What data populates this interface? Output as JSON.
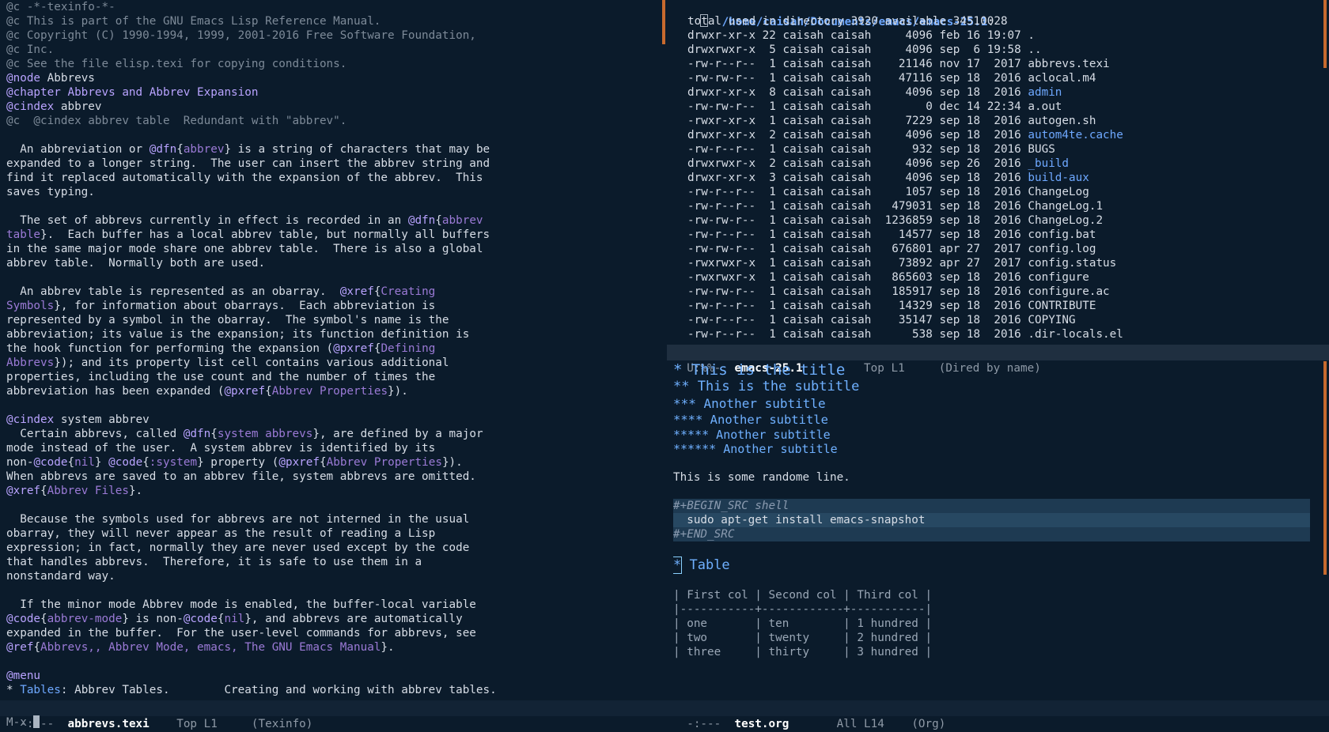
{
  "left_buffer": {
    "lines": [
      {
        "parts": [
          {
            "c": "comment",
            "t": "@c -*-texinfo-*-"
          }
        ]
      },
      {
        "parts": [
          {
            "c": "comment",
            "t": "@c This is part of the GNU Emacs Lisp Reference Manual."
          }
        ]
      },
      {
        "parts": [
          {
            "c": "comment",
            "t": "@c Copyright (C) 1990-1994, 1999, 2001-2016 Free Software Foundation,"
          }
        ]
      },
      {
        "parts": [
          {
            "c": "comment",
            "t": "@c Inc."
          }
        ]
      },
      {
        "parts": [
          {
            "c": "comment",
            "t": "@c See the file elisp.texi for copying conditions."
          }
        ]
      },
      {
        "parts": [
          {
            "c": "kw",
            "t": "@node"
          },
          {
            "c": "",
            "t": " Abbrevs"
          }
        ]
      },
      {
        "parts": [
          {
            "c": "kw",
            "t": "@chapter Abbrevs and Abbrev Expansion"
          }
        ]
      },
      {
        "parts": [
          {
            "c": "kw",
            "t": "@cindex"
          },
          {
            "c": "",
            "t": " abbrev"
          }
        ]
      },
      {
        "parts": [
          {
            "c": "comment",
            "t": "@c  @cindex abbrev table  Redundant with \"abbrev\"."
          }
        ]
      },
      {
        "parts": [
          {
            "c": "",
            "t": ""
          }
        ]
      },
      {
        "parts": [
          {
            "c": "",
            "t": "  An abbreviation or "
          },
          {
            "c": "kw",
            "t": "@dfn"
          },
          {
            "c": "",
            "t": "{"
          },
          {
            "c": "arg",
            "t": "abbrev"
          },
          {
            "c": "",
            "t": "} is a string of characters that may be"
          }
        ]
      },
      {
        "parts": [
          {
            "c": "",
            "t": "expanded to a longer string.  The user can insert the abbrev string and"
          }
        ]
      },
      {
        "parts": [
          {
            "c": "",
            "t": "find it replaced automatically with the expansion of the abbrev.  This"
          }
        ]
      },
      {
        "parts": [
          {
            "c": "",
            "t": "saves typing."
          }
        ]
      },
      {
        "parts": [
          {
            "c": "",
            "t": ""
          }
        ]
      },
      {
        "parts": [
          {
            "c": "",
            "t": "  The set of abbrevs currently in effect is recorded in an "
          },
          {
            "c": "kw",
            "t": "@dfn"
          },
          {
            "c": "",
            "t": "{"
          },
          {
            "c": "arg",
            "t": "abbrev"
          }
        ]
      },
      {
        "parts": [
          {
            "c": "arg",
            "t": "table"
          },
          {
            "c": "",
            "t": "}.  Each buffer has a local abbrev table, but normally all buffers"
          }
        ]
      },
      {
        "parts": [
          {
            "c": "",
            "t": "in the same major mode share one abbrev table.  There is also a global"
          }
        ]
      },
      {
        "parts": [
          {
            "c": "",
            "t": "abbrev table.  Normally both are used."
          }
        ]
      },
      {
        "parts": [
          {
            "c": "",
            "t": ""
          }
        ]
      },
      {
        "parts": [
          {
            "c": "",
            "t": "  An abbrev table is represented as an obarray.  "
          },
          {
            "c": "kw",
            "t": "@xref"
          },
          {
            "c": "",
            "t": "{"
          },
          {
            "c": "arg",
            "t": "Creating"
          }
        ]
      },
      {
        "parts": [
          {
            "c": "arg",
            "t": "Symbols"
          },
          {
            "c": "",
            "t": "}, for information about obarrays.  Each abbreviation is"
          }
        ]
      },
      {
        "parts": [
          {
            "c": "",
            "t": "represented by a symbol in the obarray.  The symbol's name is the"
          }
        ]
      },
      {
        "parts": [
          {
            "c": "",
            "t": "abbreviation; its value is the expansion; its function definition is"
          }
        ]
      },
      {
        "parts": [
          {
            "c": "",
            "t": "the hook function for performing the expansion ("
          },
          {
            "c": "kw",
            "t": "@pxref"
          },
          {
            "c": "",
            "t": "{"
          },
          {
            "c": "arg",
            "t": "Defining"
          }
        ]
      },
      {
        "parts": [
          {
            "c": "arg",
            "t": "Abbrevs"
          },
          {
            "c": "",
            "t": "}); and its property list cell contains various additional"
          }
        ]
      },
      {
        "parts": [
          {
            "c": "",
            "t": "properties, including the use count and the number of times the"
          }
        ]
      },
      {
        "parts": [
          {
            "c": "",
            "t": "abbreviation has been expanded ("
          },
          {
            "c": "kw",
            "t": "@pxref"
          },
          {
            "c": "",
            "t": "{"
          },
          {
            "c": "arg",
            "t": "Abbrev Properties"
          },
          {
            "c": "",
            "t": "})."
          }
        ]
      },
      {
        "parts": [
          {
            "c": "",
            "t": ""
          }
        ]
      },
      {
        "parts": [
          {
            "c": "kw",
            "t": "@cindex"
          },
          {
            "c": "",
            "t": " system abbrev"
          }
        ]
      },
      {
        "parts": [
          {
            "c": "",
            "t": "  Certain abbrevs, called "
          },
          {
            "c": "kw",
            "t": "@dfn"
          },
          {
            "c": "",
            "t": "{"
          },
          {
            "c": "arg",
            "t": "system abbrevs"
          },
          {
            "c": "",
            "t": "}, are defined by a major"
          }
        ]
      },
      {
        "parts": [
          {
            "c": "",
            "t": "mode instead of the user.  A system abbrev is identified by its"
          }
        ]
      },
      {
        "parts": [
          {
            "c": "",
            "t": "non-"
          },
          {
            "c": "kw",
            "t": "@code"
          },
          {
            "c": "",
            "t": "{"
          },
          {
            "c": "arg",
            "t": "nil"
          },
          {
            "c": "",
            "t": "} "
          },
          {
            "c": "kw",
            "t": "@code"
          },
          {
            "c": "",
            "t": "{"
          },
          {
            "c": "arg",
            "t": ":system"
          },
          {
            "c": "",
            "t": "} property ("
          },
          {
            "c": "kw",
            "t": "@pxref"
          },
          {
            "c": "",
            "t": "{"
          },
          {
            "c": "arg",
            "t": "Abbrev Properties"
          },
          {
            "c": "",
            "t": "})."
          }
        ]
      },
      {
        "parts": [
          {
            "c": "",
            "t": "When abbrevs are saved to an abbrev file, system abbrevs are omitted."
          }
        ]
      },
      {
        "parts": [
          {
            "c": "kw",
            "t": "@xref"
          },
          {
            "c": "",
            "t": "{"
          },
          {
            "c": "arg",
            "t": "Abbrev Files"
          },
          {
            "c": "",
            "t": "}."
          }
        ]
      },
      {
        "parts": [
          {
            "c": "",
            "t": ""
          }
        ]
      },
      {
        "parts": [
          {
            "c": "",
            "t": "  Because the symbols used for abbrevs are not interned in the usual"
          }
        ]
      },
      {
        "parts": [
          {
            "c": "",
            "t": "obarray, they will never appear as the result of reading a Lisp"
          }
        ]
      },
      {
        "parts": [
          {
            "c": "",
            "t": "expression; in fact, normally they are never used except by the code"
          }
        ]
      },
      {
        "parts": [
          {
            "c": "",
            "t": "that handles abbrevs.  Therefore, it is safe to use them in a"
          }
        ]
      },
      {
        "parts": [
          {
            "c": "",
            "t": "nonstandard way."
          }
        ]
      },
      {
        "parts": [
          {
            "c": "",
            "t": ""
          }
        ]
      },
      {
        "parts": [
          {
            "c": "",
            "t": "  If the minor mode Abbrev mode is enabled, the buffer-local variable"
          }
        ]
      },
      {
        "parts": [
          {
            "c": "kw",
            "t": "@code"
          },
          {
            "c": "",
            "t": "{"
          },
          {
            "c": "arg",
            "t": "abbrev-mode"
          },
          {
            "c": "",
            "t": "} is non-"
          },
          {
            "c": "kw",
            "t": "@code"
          },
          {
            "c": "",
            "t": "{"
          },
          {
            "c": "arg",
            "t": "nil"
          },
          {
            "c": "",
            "t": "}, and abbrevs are automatically"
          }
        ]
      },
      {
        "parts": [
          {
            "c": "",
            "t": "expanded in the buffer.  For the user-level commands for abbrevs, see"
          }
        ]
      },
      {
        "parts": [
          {
            "c": "kw",
            "t": "@ref"
          },
          {
            "c": "",
            "t": "{"
          },
          {
            "c": "arg",
            "t": "Abbrevs,, Abbrev Mode, emacs, The GNU Emacs Manual"
          },
          {
            "c": "",
            "t": "}."
          }
        ]
      },
      {
        "parts": [
          {
            "c": "",
            "t": ""
          }
        ]
      },
      {
        "parts": [
          {
            "c": "kw",
            "t": "@menu"
          }
        ]
      },
      {
        "parts": [
          {
            "c": "",
            "t": "* "
          },
          {
            "c": "dir",
            "t": "Tables"
          },
          {
            "c": "",
            "t": ": Abbrev Tables.        Creating and working with abbrev tables."
          }
        ]
      }
    ],
    "modeline": {
      "status": "-:---",
      "name": "abbrevs.texi",
      "position": "Top L1",
      "mode": "(Texinfo)"
    }
  },
  "dired": {
    "header": "/home/caisah/Documents/emacs/emacs-25.1",
    "header_suffix": ":",
    "total": "total used in directory 3920 available 34510028",
    "entries": [
      {
        "perm": "drwxr-xr-x",
        "links": "22",
        "owner": "caisah",
        "group": "caisah",
        "size": "4096",
        "date": "feb 16 19:07",
        "name": ".",
        "dir": false
      },
      {
        "perm": "drwxrwxr-x",
        "links": "5",
        "owner": "caisah",
        "group": "caisah",
        "size": "4096",
        "date": "sep  6 19:58",
        "name": "..",
        "dir": false
      },
      {
        "perm": "-rw-r--r--",
        "links": "1",
        "owner": "caisah",
        "group": "caisah",
        "size": "21146",
        "date": "nov 17  2017",
        "name": "abbrevs.texi",
        "dir": false
      },
      {
        "perm": "-rw-rw-r--",
        "links": "1",
        "owner": "caisah",
        "group": "caisah",
        "size": "47116",
        "date": "sep 18  2016",
        "name": "aclocal.m4",
        "dir": false
      },
      {
        "perm": "drwxr-xr-x",
        "links": "8",
        "owner": "caisah",
        "group": "caisah",
        "size": "4096",
        "date": "sep 18  2016",
        "name": "admin",
        "dir": true
      },
      {
        "perm": "-rw-rw-r--",
        "links": "1",
        "owner": "caisah",
        "group": "caisah",
        "size": "0",
        "date": "dec 14 22:34",
        "name": "a.out",
        "dir": false
      },
      {
        "perm": "-rwxr-xr-x",
        "links": "1",
        "owner": "caisah",
        "group": "caisah",
        "size": "7229",
        "date": "sep 18  2016",
        "name": "autogen.sh",
        "dir": false
      },
      {
        "perm": "drwxr-xr-x",
        "links": "2",
        "owner": "caisah",
        "group": "caisah",
        "size": "4096",
        "date": "sep 18  2016",
        "name": "autom4te.cache",
        "dir": true
      },
      {
        "perm": "-rw-r--r--",
        "links": "1",
        "owner": "caisah",
        "group": "caisah",
        "size": "932",
        "date": "sep 18  2016",
        "name": "BUGS",
        "dir": false
      },
      {
        "perm": "drwxrwxr-x",
        "links": "2",
        "owner": "caisah",
        "group": "caisah",
        "size": "4096",
        "date": "sep 26  2016",
        "name": "_build",
        "dir": true
      },
      {
        "perm": "drwxr-xr-x",
        "links": "3",
        "owner": "caisah",
        "group": "caisah",
        "size": "4096",
        "date": "sep 18  2016",
        "name": "build-aux",
        "dir": true
      },
      {
        "perm": "-rw-r--r--",
        "links": "1",
        "owner": "caisah",
        "group": "caisah",
        "size": "1057",
        "date": "sep 18  2016",
        "name": "ChangeLog",
        "dir": false
      },
      {
        "perm": "-rw-r--r--",
        "links": "1",
        "owner": "caisah",
        "group": "caisah",
        "size": "479031",
        "date": "sep 18  2016",
        "name": "ChangeLog.1",
        "dir": false
      },
      {
        "perm": "-rw-rw-r--",
        "links": "1",
        "owner": "caisah",
        "group": "caisah",
        "size": "1236859",
        "date": "sep 18  2016",
        "name": "ChangeLog.2",
        "dir": false
      },
      {
        "perm": "-rw-r--r--",
        "links": "1",
        "owner": "caisah",
        "group": "caisah",
        "size": "14577",
        "date": "sep 18  2016",
        "name": "config.bat",
        "dir": false
      },
      {
        "perm": "-rw-rw-r--",
        "links": "1",
        "owner": "caisah",
        "group": "caisah",
        "size": "676801",
        "date": "apr 27  2017",
        "name": "config.log",
        "dir": false
      },
      {
        "perm": "-rwxrwxr-x",
        "links": "1",
        "owner": "caisah",
        "group": "caisah",
        "size": "73892",
        "date": "apr 27  2017",
        "name": "config.status",
        "dir": false
      },
      {
        "perm": "-rwxrwxr-x",
        "links": "1",
        "owner": "caisah",
        "group": "caisah",
        "size": "865603",
        "date": "sep 18  2016",
        "name": "configure",
        "dir": false
      },
      {
        "perm": "-rw-rw-r--",
        "links": "1",
        "owner": "caisah",
        "group": "caisah",
        "size": "185917",
        "date": "sep 18  2016",
        "name": "configure.ac",
        "dir": false
      },
      {
        "perm": "-rw-r--r--",
        "links": "1",
        "owner": "caisah",
        "group": "caisah",
        "size": "14329",
        "date": "sep 18  2016",
        "name": "CONTRIBUTE",
        "dir": false
      },
      {
        "perm": "-rw-r--r--",
        "links": "1",
        "owner": "caisah",
        "group": "caisah",
        "size": "35147",
        "date": "sep 18  2016",
        "name": "COPYING",
        "dir": false
      },
      {
        "perm": "-rw-r--r--",
        "links": "1",
        "owner": "caisah",
        "group": "caisah",
        "size": "538",
        "date": "sep 18  2016",
        "name": ".dir-locals.el",
        "dir": false
      }
    ],
    "modeline": {
      "status": "U:%%-",
      "name": "emacs-25.1",
      "position": "Top L1",
      "mode": "(Dired by name)"
    }
  },
  "org": {
    "headings": [
      "* This is the title",
      "** This is the subtitle",
      "*** Another subtitle",
      "**** Another subtitle",
      "***** Another subtitle",
      "****** Another subtitle"
    ],
    "line": "This is some randome line.",
    "src_begin": "#+BEGIN_SRC shell",
    "src_code": "  sudo apt-get install emacs-snapshot",
    "src_end": "#+END_SRC",
    "table_heading_star": "*",
    "table_heading": " Table",
    "table": [
      "| First col | Second col | Third col |",
      "|-----------+------------+-----------|",
      "| one       | ten        | 1 hundred |",
      "| two       | twenty     | 2 hundred |",
      "| three     | thirty     | 3 hundred |"
    ],
    "modeline": {
      "status": "-:---",
      "name": "test.org",
      "position": "All L14",
      "mode": "(Org)"
    }
  },
  "minibuffer": {
    "prompt": "M-x"
  },
  "colors": {
    "background": "#0b1b2b",
    "keyword": "#b9a3ff",
    "directory": "#6ea8ff",
    "heading": "#6fb0ff",
    "scrollbar": "#c86a2e"
  }
}
